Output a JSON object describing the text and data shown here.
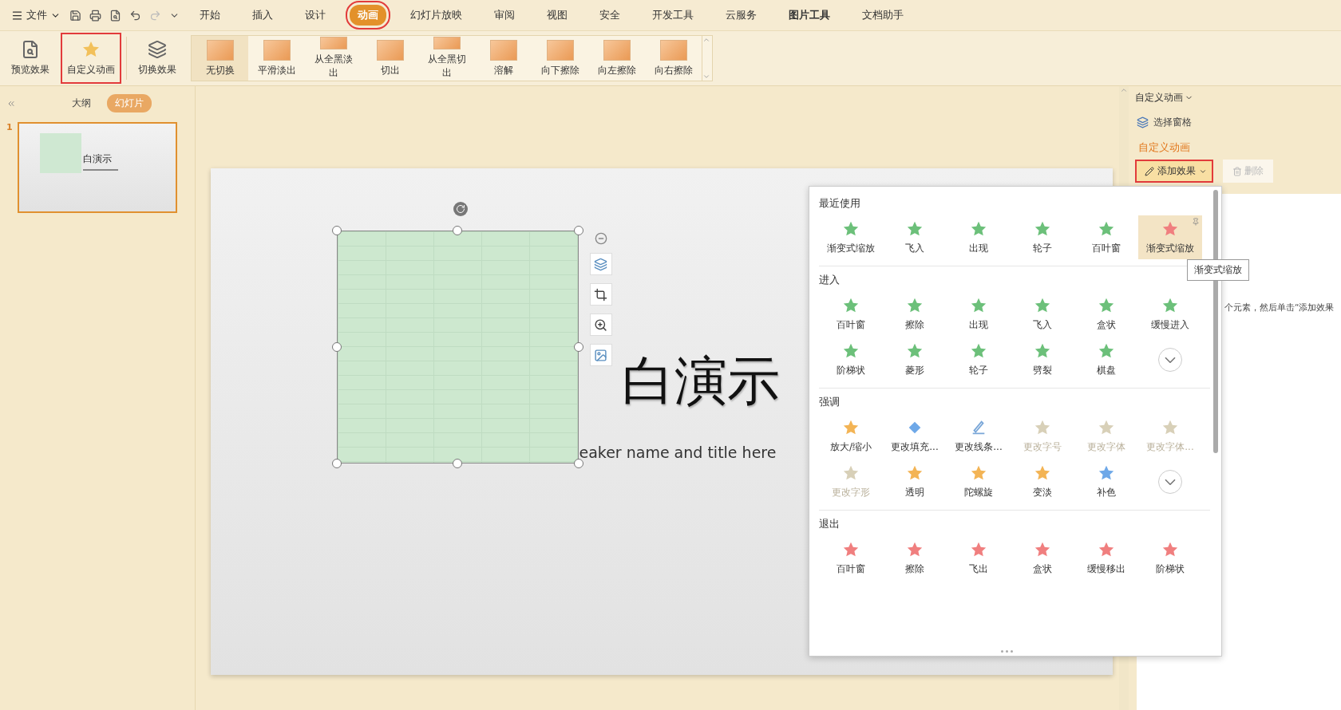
{
  "menu_bar": {
    "file_label": "文件",
    "tabs": [
      {
        "label": "开始",
        "selected": false,
        "highlighted": false
      },
      {
        "label": "插入",
        "selected": false,
        "highlighted": false
      },
      {
        "label": "设计",
        "selected": false,
        "highlighted": false
      },
      {
        "label": "动画",
        "selected": true,
        "highlighted": true
      },
      {
        "label": "幻灯片放映",
        "selected": false,
        "highlighted": false
      },
      {
        "label": "审阅",
        "selected": false,
        "highlighted": false
      },
      {
        "label": "视图",
        "selected": false,
        "highlighted": false
      },
      {
        "label": "安全",
        "selected": false,
        "highlighted": false
      },
      {
        "label": "开发工具",
        "selected": false,
        "highlighted": false
      },
      {
        "label": "云服务",
        "selected": false,
        "highlighted": false
      },
      {
        "label": "图片工具",
        "selected": false,
        "highlighted": false,
        "bold": true
      },
      {
        "label": "文档助手",
        "selected": false,
        "highlighted": false
      }
    ]
  },
  "ribbon": {
    "buttons": [
      {
        "label": "预览效果",
        "kind": "preview",
        "highlighted": false
      },
      {
        "label": "自定义动画",
        "kind": "custom",
        "highlighted": true
      },
      {
        "label": "切换效果",
        "kind": "switch",
        "highlighted": false
      }
    ],
    "transitions": [
      {
        "label": "无切换",
        "selected": true
      },
      {
        "label": "平滑淡出",
        "selected": false
      },
      {
        "label": "从全黑淡出",
        "selected": false
      },
      {
        "label": "切出",
        "selected": false
      },
      {
        "label": "从全黑切出",
        "selected": false
      },
      {
        "label": "溶解",
        "selected": false
      },
      {
        "label": "向下擦除",
        "selected": false
      },
      {
        "label": "向左擦除",
        "selected": false
      },
      {
        "label": "向右擦除",
        "selected": false
      }
    ]
  },
  "left_panel": {
    "tabs": [
      {
        "label": "大纲",
        "selected": false
      },
      {
        "label": "幻灯片",
        "selected": true
      }
    ],
    "slides": [
      {
        "number": "1",
        "title": "白演示",
        "selected": true
      }
    ]
  },
  "slide": {
    "title": "白演示",
    "subtitle": "eaker name and title here"
  },
  "right_panel": {
    "title": "自定义动画",
    "select_pane": "选择窗格",
    "section_title": "自定义动画",
    "add_button": {
      "label": "添加效果",
      "highlighted": true
    },
    "delete_button": {
      "label": "删除",
      "disabled": true
    },
    "hint": "个元素，然后单击“添加效果"
  },
  "effects_popup": {
    "sections": [
      {
        "title": "最近使用",
        "items": [
          {
            "label": "渐变式缩放",
            "kind": "entrance",
            "selected": false,
            "disabled": false
          },
          {
            "label": "飞入",
            "kind": "entrance",
            "selected": false,
            "disabled": false
          },
          {
            "label": "出现",
            "kind": "entrance",
            "selected": false,
            "disabled": false
          },
          {
            "label": "轮子",
            "kind": "entrance",
            "selected": false,
            "disabled": false
          },
          {
            "label": "百叶窗",
            "kind": "entrance",
            "selected": false,
            "disabled": false
          },
          {
            "label": "渐变式缩放",
            "kind": "exit",
            "selected": true,
            "disabled": false
          }
        ]
      },
      {
        "title": "进入",
        "items": [
          {
            "label": "百叶窗",
            "kind": "entrance",
            "selected": false,
            "disabled": false
          },
          {
            "label": "擦除",
            "kind": "entrance",
            "selected": false,
            "disabled": false
          },
          {
            "label": "出现",
            "kind": "entrance",
            "selected": false,
            "disabled": false
          },
          {
            "label": "飞入",
            "kind": "entrance",
            "selected": false,
            "disabled": false
          },
          {
            "label": "盒状",
            "kind": "entrance",
            "selected": false,
            "disabled": false
          },
          {
            "label": "缓慢进入",
            "kind": "entrance",
            "selected": false,
            "disabled": false
          },
          {
            "label": "阶梯状",
            "kind": "entrance",
            "selected": false,
            "disabled": false
          },
          {
            "label": "菱形",
            "kind": "entrance",
            "selected": false,
            "disabled": false
          },
          {
            "label": "轮子",
            "kind": "entrance",
            "selected": false,
            "disabled": false
          },
          {
            "label": "劈裂",
            "kind": "entrance",
            "selected": false,
            "disabled": false
          },
          {
            "label": "棋盘",
            "kind": "entrance",
            "selected": false,
            "disabled": false
          }
        ],
        "more": true
      },
      {
        "title": "强调",
        "items": [
          {
            "label": "放大/缩小",
            "kind": "emphasis",
            "selected": false,
            "disabled": false
          },
          {
            "label": "更改填充...",
            "kind": "fill",
            "selected": false,
            "disabled": false
          },
          {
            "label": "更改线条...",
            "kind": "line",
            "selected": false,
            "disabled": false
          },
          {
            "label": "更改字号",
            "kind": "font",
            "selected": false,
            "disabled": true
          },
          {
            "label": "更改字体",
            "kind": "font",
            "selected": false,
            "disabled": true
          },
          {
            "label": "更改字体...",
            "kind": "font",
            "selected": false,
            "disabled": true
          },
          {
            "label": "更改字形",
            "kind": "font",
            "selected": false,
            "disabled": true
          },
          {
            "label": "透明",
            "kind": "emphasis",
            "selected": false,
            "disabled": false
          },
          {
            "label": "陀螺旋",
            "kind": "emphasis",
            "selected": false,
            "disabled": false
          },
          {
            "label": "变淡",
            "kind": "emphasis",
            "selected": false,
            "disabled": false
          },
          {
            "label": "补色",
            "kind": "complement",
            "selected": false,
            "disabled": false
          }
        ],
        "more": true
      },
      {
        "title": "退出",
        "items": [
          {
            "label": "百叶窗",
            "kind": "exit",
            "selected": false,
            "disabled": false
          },
          {
            "label": "擦除",
            "kind": "exit",
            "selected": false,
            "disabled": false
          },
          {
            "label": "飞出",
            "kind": "exit",
            "selected": false,
            "disabled": false
          },
          {
            "label": "盒状",
            "kind": "exit",
            "selected": false,
            "disabled": false
          },
          {
            "label": "缓慢移出",
            "kind": "exit",
            "selected": false,
            "disabled": false
          },
          {
            "label": "阶梯状",
            "kind": "exit",
            "selected": false,
            "disabled": false
          }
        ]
      }
    ]
  },
  "tooltip": "渐变式缩放"
}
